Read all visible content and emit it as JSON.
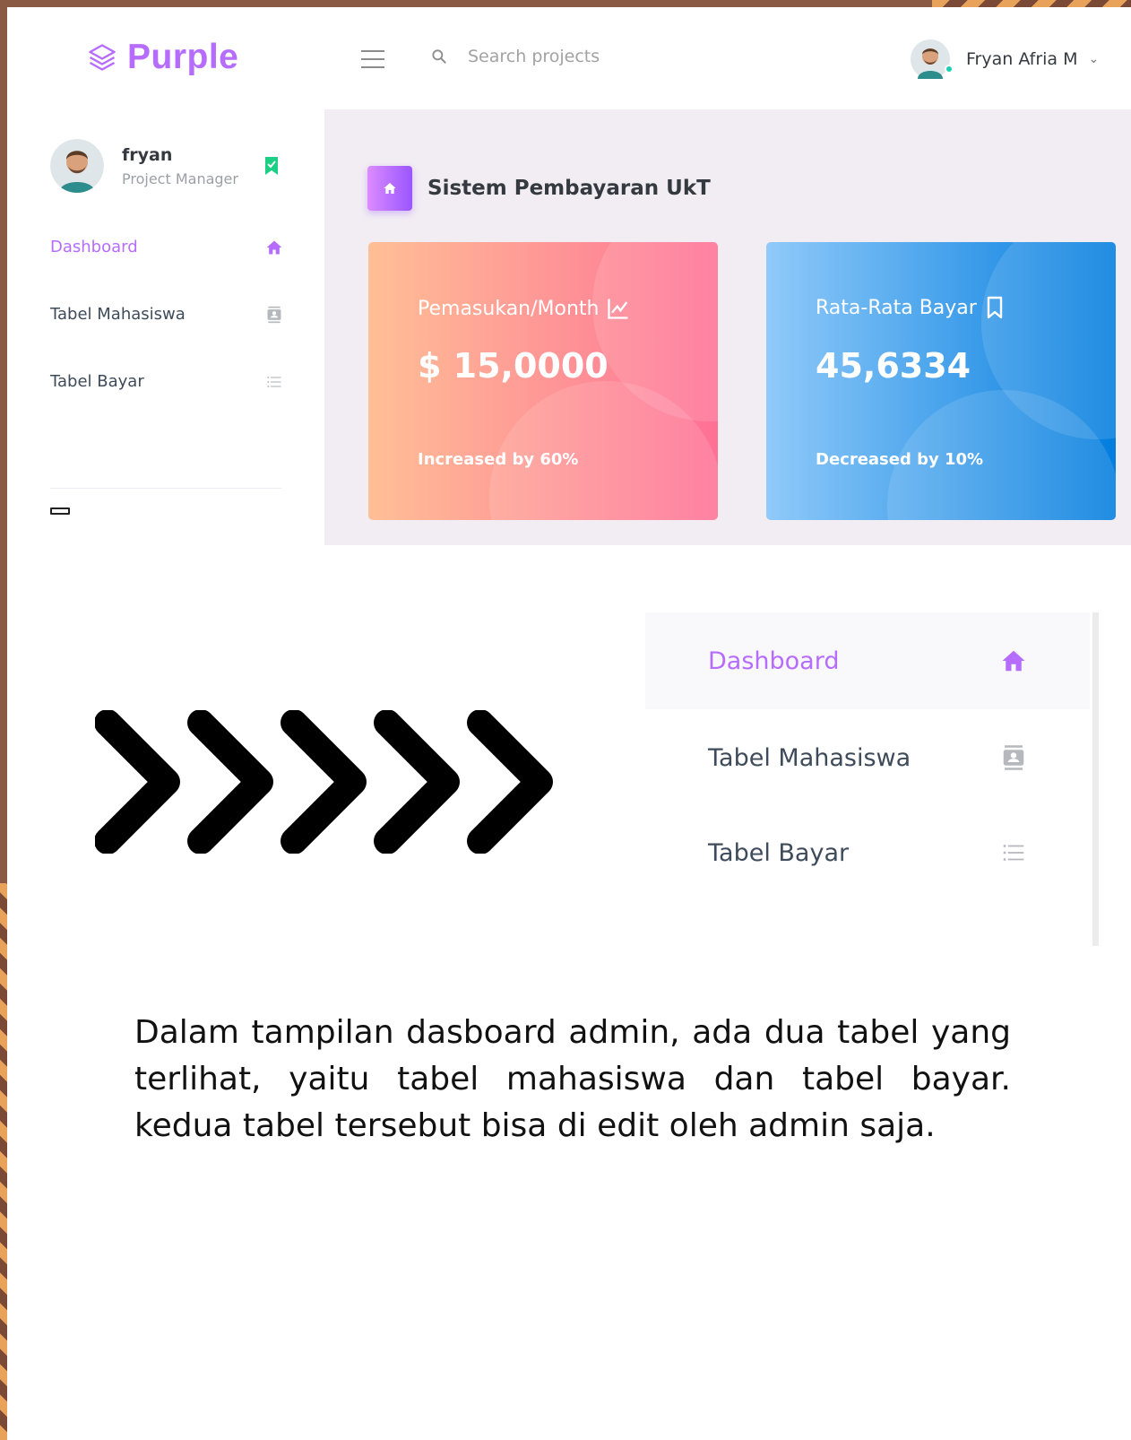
{
  "brand": {
    "name": "Purple",
    "color": "#b66dff"
  },
  "search": {
    "placeholder": "Search projects"
  },
  "user": {
    "name": "Fryan Afria M"
  },
  "profile": {
    "name": "fryan",
    "role": "Project Manager"
  },
  "sidebar": {
    "items": [
      {
        "label": "Dashboard",
        "icon": "home-icon",
        "active": true
      },
      {
        "label": "Tabel Mahasiswa",
        "icon": "contacts-icon",
        "active": false
      },
      {
        "label": "Tabel Bayar",
        "icon": "format-list-bulleted-icon",
        "active": false
      }
    ]
  },
  "page": {
    "title": "Sistem Pembayaran UkT"
  },
  "cards": [
    {
      "title": "Pemasukan/Month",
      "icon": "chart-line-icon",
      "value": "$ 15,0000",
      "foot": "Increased by 60%",
      "gradient": [
        "#ffbf96",
        "#fe7096"
      ]
    },
    {
      "title": "Rata-Rata Bayar",
      "icon": "bookmark-outline-icon",
      "value": "45,6334",
      "foot": "Decreased by 10%",
      "gradient": [
        "#90caf9",
        "#047edf"
      ]
    }
  ],
  "zoom_menu": {
    "items": [
      {
        "label": "Dashboard",
        "icon": "home-icon",
        "active": true
      },
      {
        "label": "Tabel Mahasiswa",
        "icon": "contacts-icon",
        "active": false
      },
      {
        "label": "Tabel Bayar",
        "icon": "format-list-bulleted-icon",
        "active": false
      }
    ]
  },
  "description": "Dalam tampilan dasboard admin, ada dua tabel yang terlihat, yaitu tabel mahasiswa dan tabel bayar. kedua tabel tersebut bisa di edit oleh admin saja."
}
